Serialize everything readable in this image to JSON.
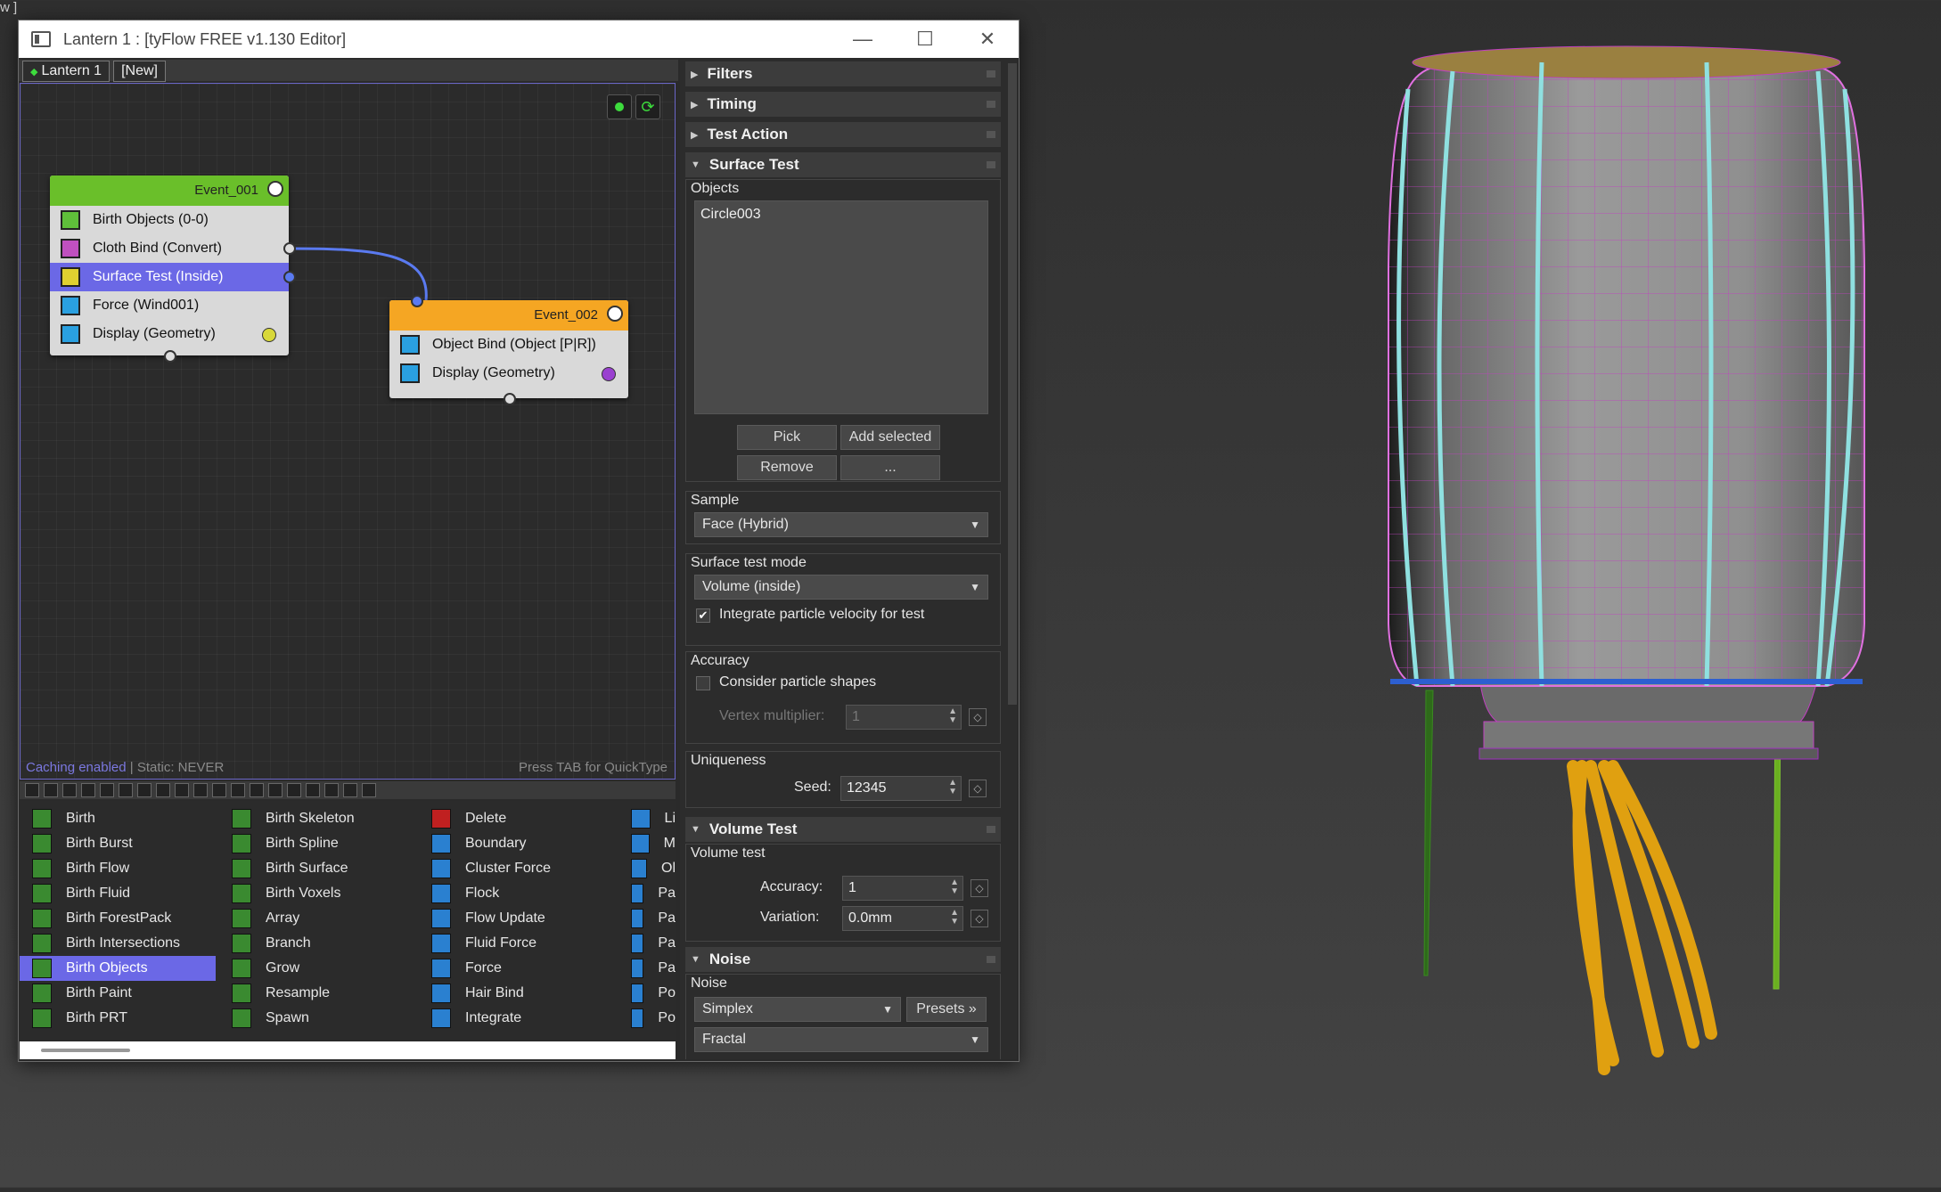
{
  "corner_text": "w ]",
  "window": {
    "title": "Lantern 1 : [tyFlow FREE v1.130 Editor]",
    "minimize": "—",
    "maximize": "☐",
    "close": "✕"
  },
  "tabs": [
    {
      "label": "Lantern 1"
    },
    {
      "label": "[New]"
    }
  ],
  "canvas": {
    "caching_label": "Caching enabled",
    "static_label": " | Static: NEVER",
    "press_tab": "Press TAB for QuickType"
  },
  "events": [
    {
      "name": "Event_001",
      "header_color": "#6abf2a",
      "operators": [
        {
          "label": "Birth Objects (0-0)",
          "icon_color": "#5fbf3a"
        },
        {
          "label": "Cloth Bind (Convert)",
          "icon_color": "#c050c0"
        },
        {
          "label": "Surface Test (Inside)",
          "icon_color": "#e0d030"
        },
        {
          "label": "Force (Wind001)",
          "icon_color": "#2aa0e0"
        },
        {
          "label": "Display (Geometry)",
          "icon_color": "#2aa0e0",
          "display_color": "#d8d83a"
        }
      ]
    },
    {
      "name": "Event_002",
      "header_color": "#f5a623",
      "operators": [
        {
          "label": "Object Bind (Object [P|R])",
          "icon_color": "#2aa0e0"
        },
        {
          "label": "Display (Geometry)",
          "icon_color": "#2aa0e0",
          "display_color": "#9a40d0"
        }
      ]
    }
  ],
  "operator_list": {
    "col1": [
      "Birth",
      "Birth Burst",
      "Birth Flow",
      "Birth Fluid",
      "Birth ForestPack",
      "Birth Intersections",
      "Birth Objects",
      "Birth Paint",
      "Birth PRT"
    ],
    "col2": [
      "Birth Skeleton",
      "Birth Spline",
      "Birth Surface",
      "Birth Voxels",
      "Array",
      "Branch",
      "Grow",
      "Resample",
      "Spawn"
    ],
    "col3": [
      "Delete",
      "Boundary",
      "Cluster Force",
      "Flock",
      "Flow Update",
      "Fluid Force",
      "Force",
      "Hair Bind",
      "Integrate"
    ],
    "col4": [
      "Li",
      "M",
      "Ol",
      "Pa",
      "Pa",
      "Pa",
      "Pa",
      "Po",
      "Po"
    ],
    "selected": "Birth Objects"
  },
  "panel": {
    "rollups": {
      "filters": "Filters",
      "timing": "Timing",
      "test_action": "Test Action",
      "surface_test": "Surface Test",
      "volume_test": "Volume Test",
      "noise": "Noise"
    },
    "objects_label": "Objects",
    "objects_list": [
      "Circle003"
    ],
    "pick": "Pick",
    "add_selected": "Add selected",
    "remove": "Remove",
    "more": "...",
    "sample_label": "Sample",
    "sample_value": "Face (Hybrid)",
    "mode_label": "Surface test mode",
    "mode_value": "Volume (inside)",
    "integrate_label": "Integrate particle velocity for test",
    "integrate_checked": true,
    "accuracy_group": "Accuracy",
    "consider_label": "Consider particle shapes",
    "consider_checked": false,
    "vertex_mult_label": "Vertex multiplier:",
    "vertex_mult_value": "1",
    "uniqueness_label": "Uniqueness",
    "seed_label": "Seed:",
    "seed_value": "12345",
    "volume_test_label": "Volume test",
    "accuracy_label": "Accuracy:",
    "accuracy_value": "1",
    "variation_label": "Variation:",
    "variation_value": "0.0mm",
    "noise_label": "Noise",
    "noise_type": "Simplex",
    "presets": "Presets »",
    "fractal": "Fractal"
  }
}
